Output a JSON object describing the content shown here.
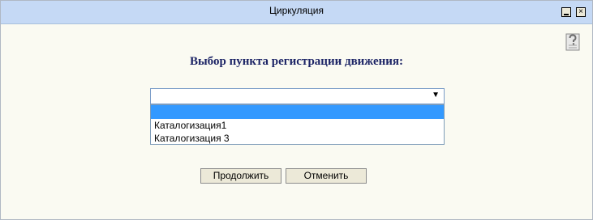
{
  "window": {
    "title": "Циркуляция",
    "minimize_glyph": "_",
    "close_glyph": "×"
  },
  "help": {
    "icon": "help-icon"
  },
  "main": {
    "heading": "Выбор пункта регистрации движения:",
    "select": {
      "value": "",
      "arrow": "▼",
      "options": [
        "",
        "Каталогизация1",
        "Каталогизация 3"
      ],
      "highlighted_index": 0
    }
  },
  "buttons": {
    "continue_label": "Продолжить",
    "cancel_label": "Отменить"
  },
  "colors": {
    "titlebar": "#c5d9f5",
    "background": "#fafaf2",
    "heading": "#1c2466",
    "selection": "#3399ff"
  }
}
